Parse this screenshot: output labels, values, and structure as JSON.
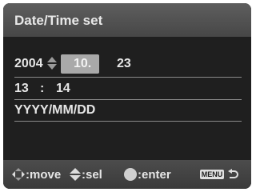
{
  "header": {
    "title": "Date/Time set"
  },
  "date_row": {
    "year": "2004",
    "month": "10.",
    "day": "23"
  },
  "time_row": {
    "hour": "13",
    "separator": ":",
    "minute": "14"
  },
  "format_row": {
    "format": "YYYY/MM/DD"
  },
  "footer": {
    "move_label": ":move",
    "sel_label": ":sel",
    "enter_label": ":enter",
    "menu_label": "MENU"
  },
  "icons": {
    "move": "four-way-arrow-icon",
    "select": "up-down-arrow-icon",
    "enter": "center-button-icon",
    "back": "back-arrow-icon"
  },
  "colors": {
    "screen_bg": "#1f1f1f",
    "title_bg": "#555555",
    "highlight": "#a9a9a9",
    "text": "#e6e6e6"
  }
}
